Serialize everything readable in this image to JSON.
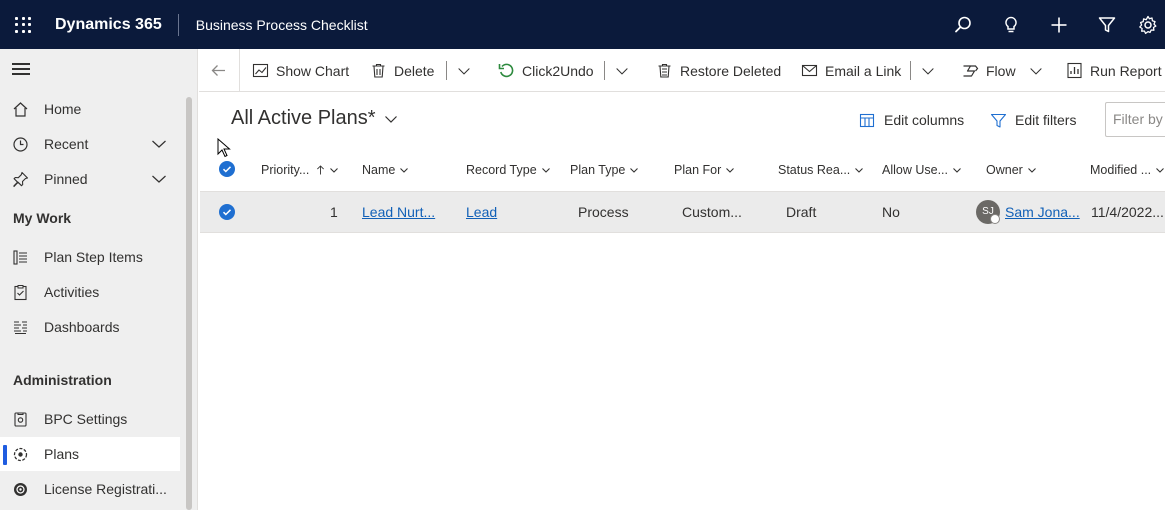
{
  "topbar": {
    "app_name": "Dynamics 365",
    "app_title": "Business Process Checklist",
    "icons": [
      "search-icon",
      "lightbulb-icon",
      "plus-icon",
      "filter-icon",
      "gear-icon"
    ]
  },
  "sidebar": {
    "items": [
      {
        "label": "Home",
        "icon": "home-icon"
      },
      {
        "label": "Recent",
        "icon": "clock-icon"
      },
      {
        "label": "Pinned",
        "icon": "pin-icon"
      }
    ],
    "sections": [
      {
        "title": "My Work",
        "items": [
          {
            "label": "Plan Step Items",
            "icon": "list-icon"
          },
          {
            "label": "Activities",
            "icon": "clipboard-icon"
          },
          {
            "label": "Dashboards",
            "icon": "dashboard-icon"
          }
        ]
      },
      {
        "title": "Administration",
        "items": [
          {
            "label": "BPC Settings",
            "icon": "settings-icon"
          },
          {
            "label": "Plans",
            "icon": "plans-icon",
            "selected": true
          },
          {
            "label": "License Registrati...",
            "icon": "license-icon"
          }
        ]
      }
    ]
  },
  "commandbar": {
    "show_chart": "Show Chart",
    "delete": "Delete",
    "click2undo": "Click2Undo",
    "restore_deleted": "Restore Deleted",
    "email_link": "Email a Link",
    "flow": "Flow",
    "run_report": "Run Report"
  },
  "view": {
    "title": "All Active Plans*",
    "edit_columns": "Edit columns",
    "edit_filters": "Edit filters",
    "filter_placeholder": "Filter by keyword"
  },
  "grid": {
    "columns": [
      "Priority...",
      "Name",
      "Record Type",
      "Plan Type",
      "Plan For",
      "Status Rea...",
      "Allow Use...",
      "Owner",
      "Modified ..."
    ],
    "rows": [
      {
        "priority": "1",
        "name": "Lead Nurt...",
        "record_type": "Lead",
        "plan_type": "Process",
        "plan_for": "Custom...",
        "status_reason": "Draft",
        "allow_use": "No",
        "owner_initials": "SJ",
        "owner": "Sam Jona...",
        "modified": "11/4/2022..."
      }
    ]
  },
  "colors": {
    "topbar": "#0b1a3b",
    "accent": "#1f6fd1",
    "link": "#1160b7"
  }
}
